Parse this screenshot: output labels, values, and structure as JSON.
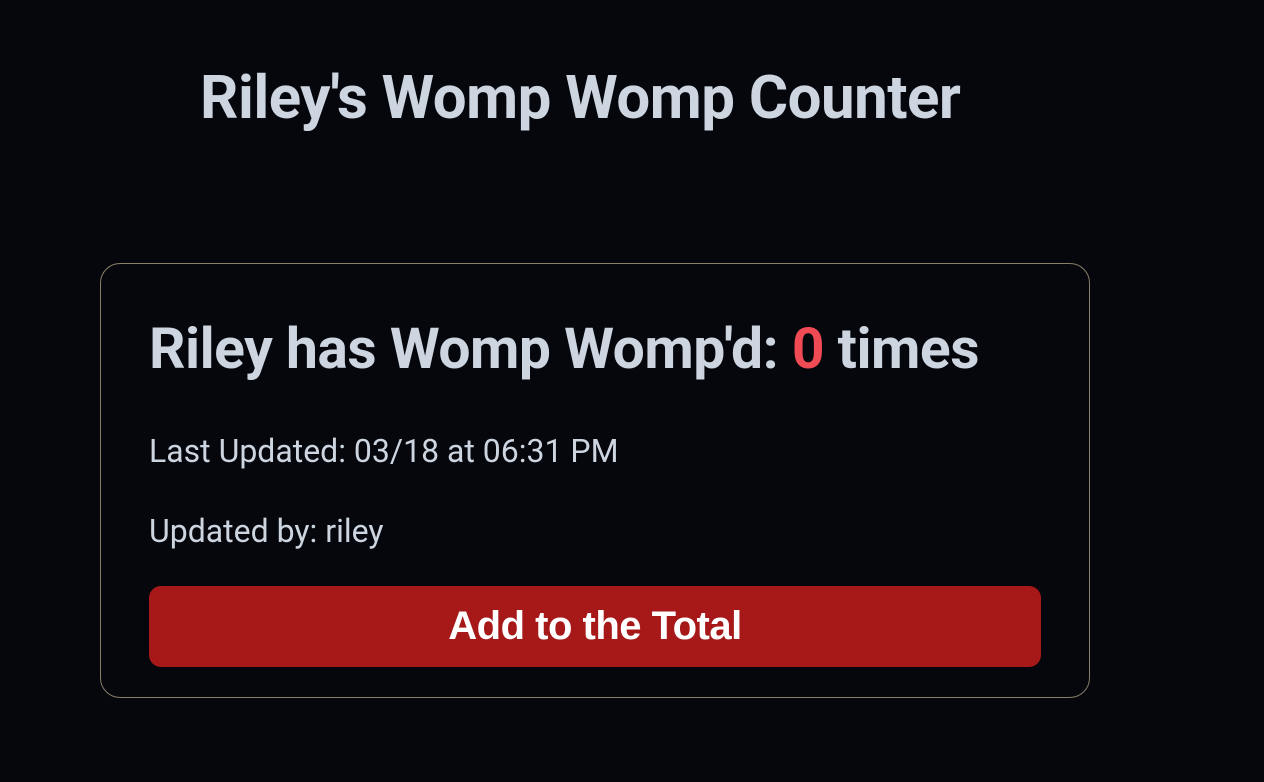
{
  "header": {
    "title": "Riley's Womp Womp Counter"
  },
  "card": {
    "count_prefix": "Riley has Womp Womp'd: ",
    "count_value": "0",
    "count_suffix": " times",
    "last_updated_label": "Last Updated: ",
    "last_updated_value": "03/18 at 06:31 PM",
    "updated_by_label": "Updated by: ",
    "updated_by_value": "riley",
    "button_label": "Add to the Total"
  }
}
